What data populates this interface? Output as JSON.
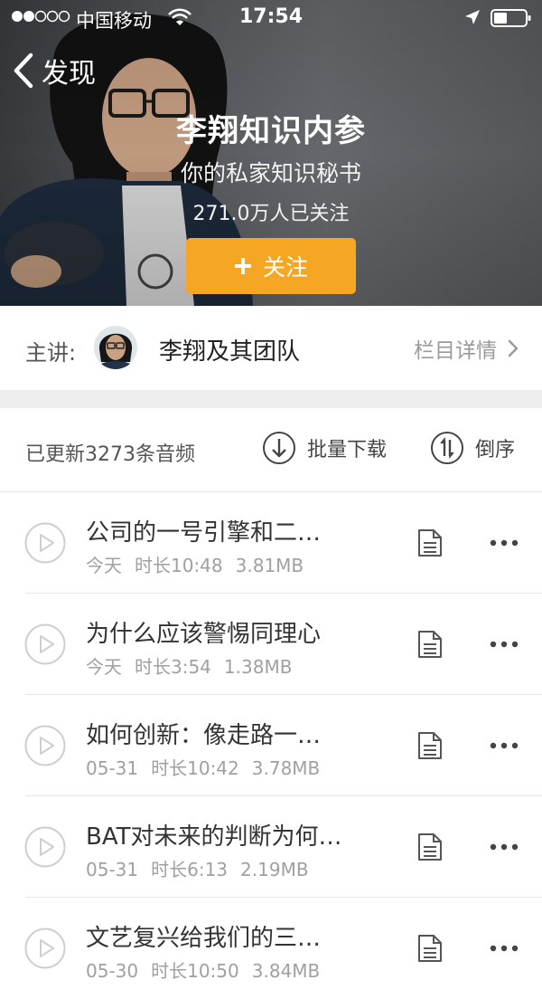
{
  "status_bar": {
    "carrier": "中国移动",
    "time": "17:54",
    "icons": [
      "signal-dots-icon",
      "wifi-icon",
      "location-arrow-icon",
      "battery-icon"
    ]
  },
  "nav": {
    "back_label": "发现"
  },
  "column": {
    "title": "李翔知识内参",
    "subtitle": "你的私家知识秘书",
    "followers": "271.0万人已关注",
    "follow_label": "关注"
  },
  "speaker": {
    "label": "主讲:",
    "name": "李翔及其团队",
    "detail_link": "栏目详情"
  },
  "toolbar": {
    "update_count": "已更新3273条音频",
    "batch_download": "批量下载",
    "reverse_order": "倒序"
  },
  "episodes": [
    {
      "title": "公司的一号引擎和二…",
      "date": "今天",
      "duration": "时长10:48",
      "size": "3.81MB"
    },
    {
      "title": "为什么应该警惕同理心",
      "date": "今天",
      "duration": "时长3:54",
      "size": "1.38MB"
    },
    {
      "title": "如何创新：像走路一…",
      "date": "05-31",
      "duration": "时长10:42",
      "size": "3.78MB"
    },
    {
      "title": "BAT对未来的判断为何…",
      "date": "05-31",
      "duration": "时长6:13",
      "size": "2.19MB"
    },
    {
      "title": "文艺复兴给我们的三…",
      "date": "05-30",
      "duration": "时长10:50",
      "size": "3.84MB"
    }
  ],
  "colors": {
    "accent_orange": "#f5a623",
    "header_dark": "#4a4d50"
  }
}
